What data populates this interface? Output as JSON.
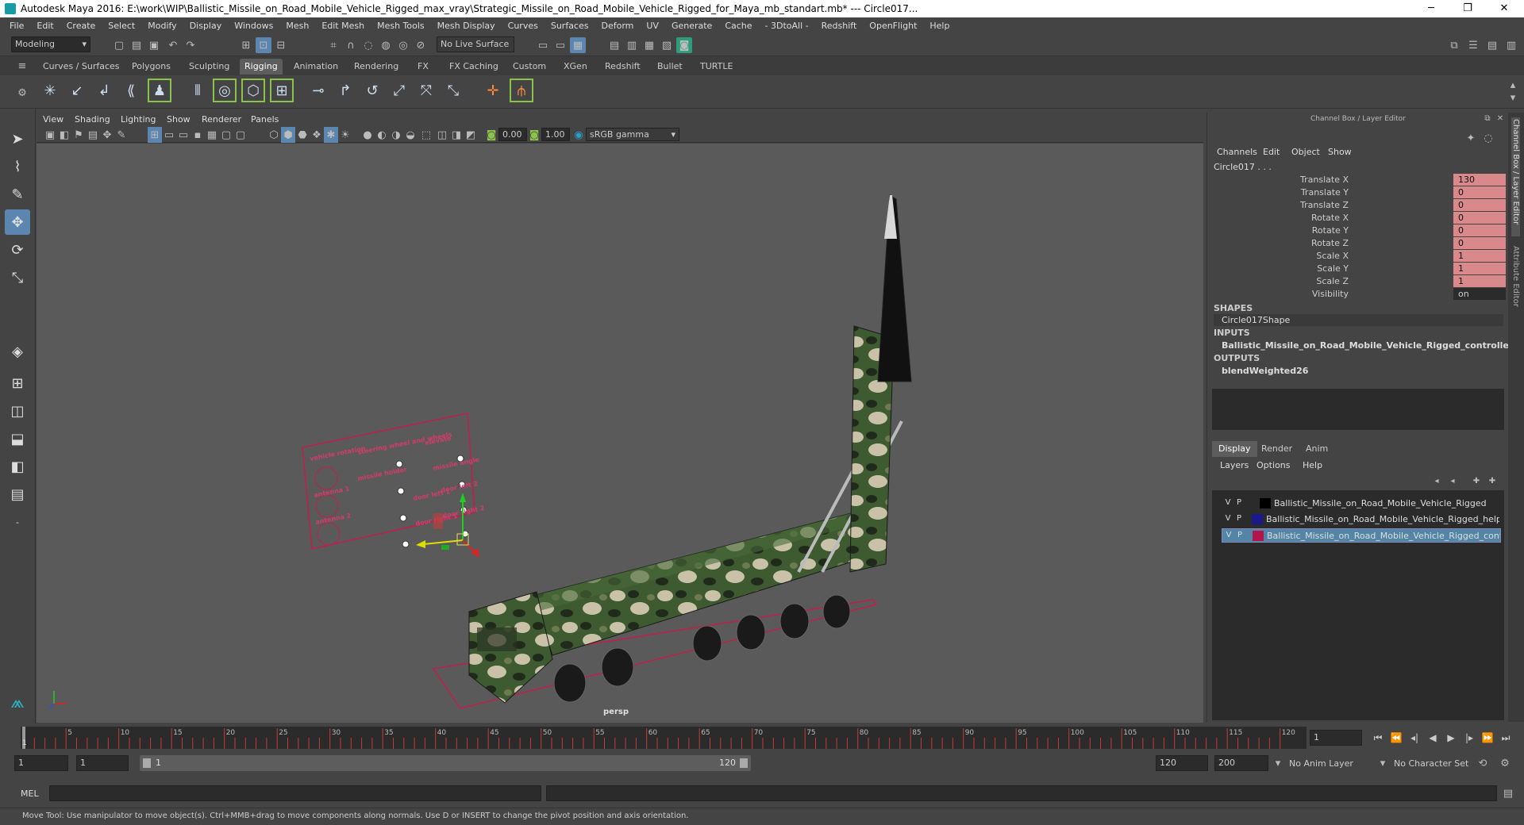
{
  "window": {
    "title": "Autodesk Maya 2016: E:\\work\\WIP\\Ballistic_Missile_on_Road_Mobile_Vehicle_Rigged_max_vray\\Strategic_Missile_on_Road_Mobile_Vehicle_Rigged_for_Maya_mb_standart.mb*   ---   Circle017...",
    "minimize": "─",
    "maximize": "❐",
    "close": "✕"
  },
  "menus": [
    "File",
    "Edit",
    "Create",
    "Select",
    "Modify",
    "Display",
    "Windows",
    "Mesh",
    "Edit Mesh",
    "Mesh Tools",
    "Mesh Display",
    "Curves",
    "Surfaces",
    "Deform",
    "UV",
    "Generate",
    "Cache",
    "- 3DtoAll -",
    "Redshift",
    "OpenFlight",
    "Help"
  ],
  "statusline": {
    "mode": "Modeling",
    "live_surface": "No Live Surface"
  },
  "shelf_tabs": [
    "Curves / Surfaces",
    "Polygons",
    "Sculpting",
    "Rigging",
    "Animation",
    "Rendering",
    "FX",
    "FX Caching",
    "Custom",
    "XGen",
    "Redshift",
    "Bullet",
    "TURTLE"
  ],
  "shelf_active": "Rigging",
  "viewport": {
    "menus": [
      "View",
      "Shading",
      "Lighting",
      "Show",
      "Renderer",
      "Panels"
    ],
    "exposure": "0.00",
    "gamma": "1.00",
    "colorspace": "sRGB gamma",
    "camera_label": "persp",
    "control_labels": [
      "vehicle rotation",
      "steering wheel and wheels",
      "elevate",
      "missile holder",
      "missile angle",
      "antenna 1",
      "door left 1",
      "door left 2",
      "antenna 2",
      "door right 1",
      "door right 2"
    ]
  },
  "channel_box": {
    "title": "Channel Box / Layer Editor",
    "menus": [
      "Channels",
      "Edit",
      "Object",
      "Show"
    ],
    "object_name": "Circle017 . . .",
    "channels": [
      {
        "label": "Translate X",
        "value": "130"
      },
      {
        "label": "Translate Y",
        "value": "0"
      },
      {
        "label": "Translate Z",
        "value": "0"
      },
      {
        "label": "Rotate X",
        "value": "0"
      },
      {
        "label": "Rotate Y",
        "value": "0"
      },
      {
        "label": "Rotate Z",
        "value": "0"
      },
      {
        "label": "Scale X",
        "value": "1"
      },
      {
        "label": "Scale Y",
        "value": "1"
      },
      {
        "label": "Scale Z",
        "value": "1"
      },
      {
        "label": "Visibility",
        "value": "on"
      }
    ],
    "shapes_title": "SHAPES",
    "shape": "Circle017Shape",
    "inputs_title": "INPUTS",
    "input": "Ballistic_Missile_on_Road_Mobile_Vehicle_Rigged_controllers",
    "outputs_title": "OUTPUTS",
    "output": "blendWeighted26"
  },
  "layer_editor": {
    "tabs": [
      "Display",
      "Render",
      "Anim"
    ],
    "active_tab": "Display",
    "menus": [
      "Layers",
      "Options",
      "Help"
    ],
    "layers": [
      {
        "v": "V",
        "p": "P",
        "color": "#000000",
        "name": "Ballistic_Missile_on_Road_Mobile_Vehicle_Rigged"
      },
      {
        "v": "V",
        "p": "P",
        "color": "#1a1a8c",
        "name": "Ballistic_Missile_on_Road_Mobile_Vehicle_Rigged_helpe"
      },
      {
        "v": "V",
        "p": "P",
        "color": "#b0164a",
        "name": "Ballistic_Missile_on_Road_Mobile_Vehicle_Rigged_contro"
      }
    ]
  },
  "side_tabs": [
    "Channel Box / Layer Editor",
    "Attribute Editor"
  ],
  "timeline": {
    "tick_labels": [
      "5",
      "10",
      "15",
      "20",
      "25",
      "30",
      "35",
      "40",
      "45",
      "50",
      "55",
      "60",
      "65",
      "70",
      "75",
      "80",
      "85",
      "90",
      "95",
      "100",
      "105",
      "110",
      "115",
      "120"
    ],
    "current_frame": "1",
    "start_marker": "1"
  },
  "range": {
    "start": "1",
    "playback_start": "1",
    "slider_start": "1",
    "slider_end": "120",
    "playback_end": "120",
    "end": "200",
    "anim_layer": "No Anim Layer",
    "character_set": "No Character Set"
  },
  "playback_buttons": [
    "⏮",
    "⏪",
    "◂|",
    "◀",
    "▶",
    "|▸",
    "⏩",
    "⏭"
  ],
  "cmdline": {
    "label": "MEL"
  },
  "helpline": "Move Tool: Use manipulator to move object(s). Ctrl+MMB+drag to move components along normals. Use D or INSERT to change the pivot position and axis orientation."
}
